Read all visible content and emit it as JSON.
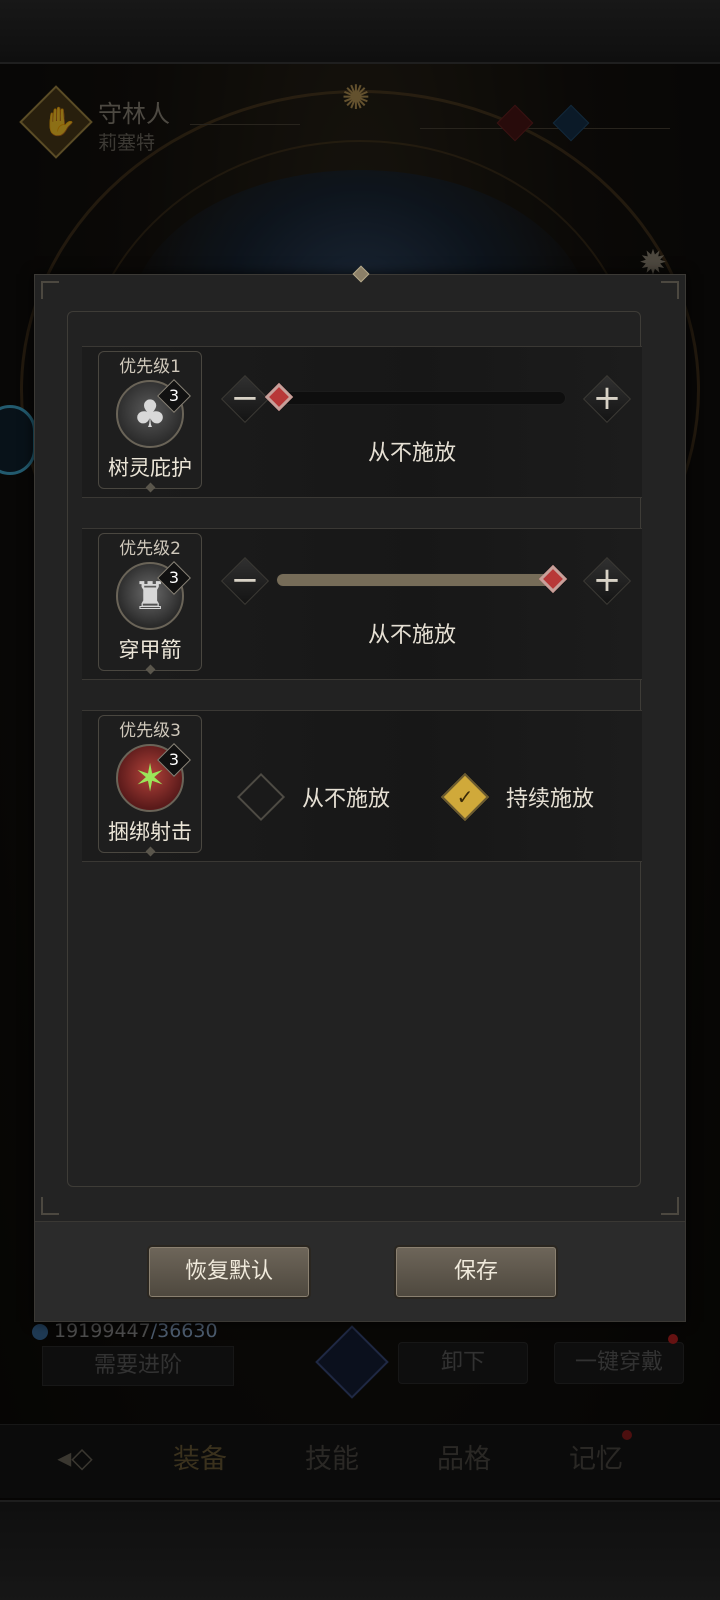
{
  "character": {
    "name": "守林人",
    "subtitle": "莉塞特"
  },
  "background": {
    "currency_current": "19199447",
    "currency_required": "/36630",
    "advance_button": "需要进阶",
    "unequip_button": "卸下",
    "equip_all_button": "一键穿戴",
    "tabs": [
      "装备",
      "技能",
      "品格",
      "记忆"
    ]
  },
  "skills": [
    {
      "priority": "优先级1",
      "name": "树灵庇护",
      "level": "3",
      "icon": "tree-icon",
      "control": "slider",
      "slider_level": 0.0,
      "status": "从不施放"
    },
    {
      "priority": "优先级2",
      "name": "穿甲箭",
      "level": "3",
      "icon": "archer-icon",
      "control": "slider",
      "slider_level": 1.0,
      "status": "从不施放"
    },
    {
      "priority": "优先级3",
      "name": "捆绑射击",
      "level": "3",
      "icon": "bind-shot-icon",
      "control": "choice",
      "options": [
        {
          "label": "从不施放",
          "checked": false
        },
        {
          "label": "持续施放",
          "checked": true
        }
      ]
    }
  ],
  "stepper": {
    "minus": "−",
    "plus": "+"
  },
  "footer": {
    "reset_button": "恢复默认",
    "save_button": "保存"
  },
  "colors": {
    "panel": "#232323",
    "accent_gold": "#d0a93a",
    "knob_red": "#b83838",
    "slider_fill": "#766c58"
  }
}
